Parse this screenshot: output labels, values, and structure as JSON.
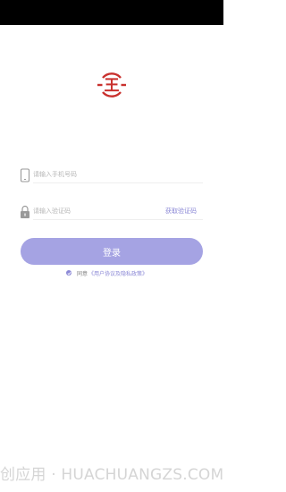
{
  "colors": {
    "accent": "#8b88d6",
    "button_bg": "#a5a3e3",
    "logo_red": "#c9312e",
    "status_bar": "#000000",
    "placeholder": "#b7b7b7"
  },
  "logo": {
    "icon": "wang-logo-icon",
    "text": "王"
  },
  "phone_field": {
    "icon": "phone-icon",
    "placeholder": "请输入手机号码",
    "value": ""
  },
  "code_field": {
    "icon": "lock-icon",
    "placeholder": "请输入验证码",
    "value": "",
    "get_code_label": "获取验证码"
  },
  "login_button": {
    "label": "登录"
  },
  "agreement": {
    "checked": true,
    "prefix": "同意",
    "policy_link": "《用户协议及隐私政策》"
  },
  "watermark": {
    "text": "创应用 · HUACHUANGZS.COM"
  }
}
